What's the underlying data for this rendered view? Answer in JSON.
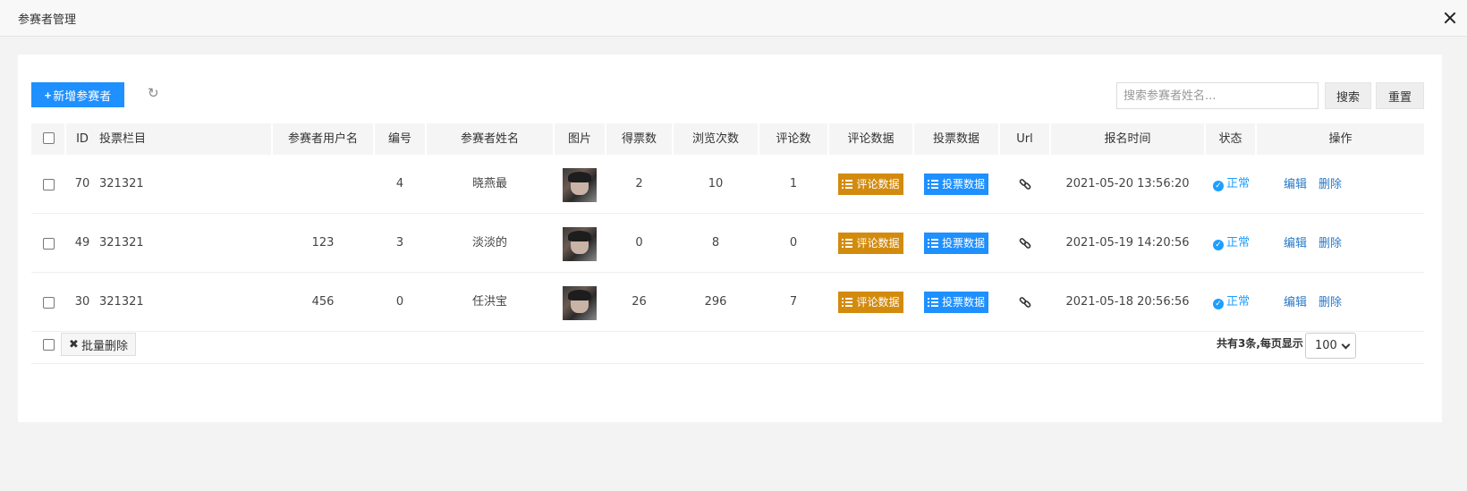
{
  "window": {
    "title": "参赛者管理"
  },
  "toolbar": {
    "add_label": "新增参赛者",
    "search_placeholder": "搜索参赛者姓名...",
    "search_label": "搜索",
    "reset_label": "重置"
  },
  "table": {
    "headers": {
      "id": "ID",
      "column": "投票栏目",
      "username": "参赛者用户名",
      "number": "编号",
      "name": "参赛者姓名",
      "image": "图片",
      "votes": "得票数",
      "views": "浏览次数",
      "comments": "评论数",
      "comment_data": "评论数据",
      "vote_data": "投票数据",
      "url": "Url",
      "time": "报名时间",
      "status": "状态",
      "ops": "操作"
    },
    "rows": [
      {
        "id": "70",
        "column": "321321",
        "username": "",
        "number": "4",
        "name": "晓燕最",
        "votes": "2",
        "views": "10",
        "comments": "1",
        "time": "2021-05-20 13:56:20",
        "status": "正常"
      },
      {
        "id": "49",
        "column": "321321",
        "username": "123",
        "number": "3",
        "name": "淡淡的",
        "votes": "0",
        "views": "8",
        "comments": "0",
        "time": "2021-05-19 14:20:56",
        "status": "正常"
      },
      {
        "id": "30",
        "column": "321321",
        "username": "456",
        "number": "0",
        "name": "任洪宝",
        "votes": "26",
        "views": "296",
        "comments": "7",
        "time": "2021-05-18 20:56:56",
        "status": "正常"
      }
    ],
    "comment_data_label": "评论数据",
    "vote_data_label": "投票数据",
    "edit_label": "编辑",
    "delete_label": "删除"
  },
  "footer": {
    "batch_delete_label": "批量删除",
    "page_info": "共有3条,每页显示",
    "page_size": "100"
  },
  "colors": {
    "primary": "#1e90ff",
    "orange": "#d38b0e",
    "status": "#1e9fff",
    "link": "#2a7ac8"
  }
}
